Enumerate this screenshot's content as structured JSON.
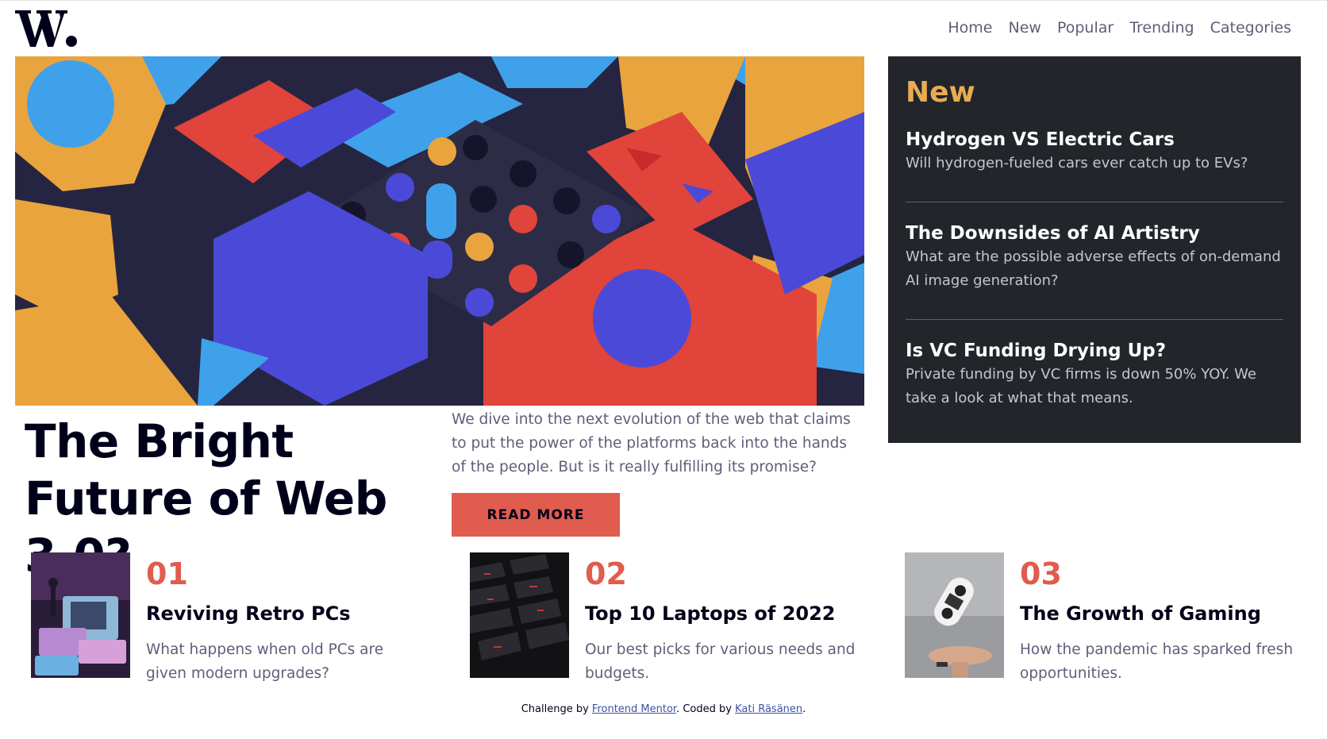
{
  "header": {
    "logo_text": "W.",
    "nav": [
      "Home",
      "New",
      "Popular",
      "Trending",
      "Categories"
    ]
  },
  "hero": {
    "title": "The Bright Future of Web 3.0?",
    "description": "We dive into the next evolution of the web that claims to put the power of the platforms back into the hands of the people. But is it really fulfilling its promise?",
    "button_label": "READ MORE"
  },
  "new_panel": {
    "heading": "New",
    "items": [
      {
        "title": "Hydrogen VS Electric Cars",
        "text": "Will hydrogen-fueled cars ever catch up to EVs?"
      },
      {
        "title": "The Downsides of AI Artistry",
        "text": "What are the possible adverse effects of on-demand AI image generation?"
      },
      {
        "title": "Is VC Funding Drying Up?",
        "text": "Private funding by VC firms is down 50% YOY. We take a look at what that means."
      }
    ]
  },
  "cards": [
    {
      "number": "01",
      "title": "Reviving Retro PCs",
      "text": "What happens when old PCs are given modern upgrades?"
    },
    {
      "number": "02",
      "title": "Top 10 Laptops of 2022",
      "text": "Our best picks for various needs and budgets."
    },
    {
      "number": "03",
      "title": "The Growth of Gaming",
      "text": "How the pandemic has sparked fresh opportunities."
    }
  ],
  "footer": {
    "prefix": "Challenge by ",
    "link1": "Frontend Mentor",
    "middle": ". Coded by ",
    "link2": "Kati Räsänen",
    "suffix": "."
  },
  "colors": {
    "accent_red": "#e05c4e",
    "accent_orange": "#e9ab53",
    "dark_panel": "#22252a",
    "text_dark": "#00001a",
    "text_grey": "#5d5f79"
  }
}
